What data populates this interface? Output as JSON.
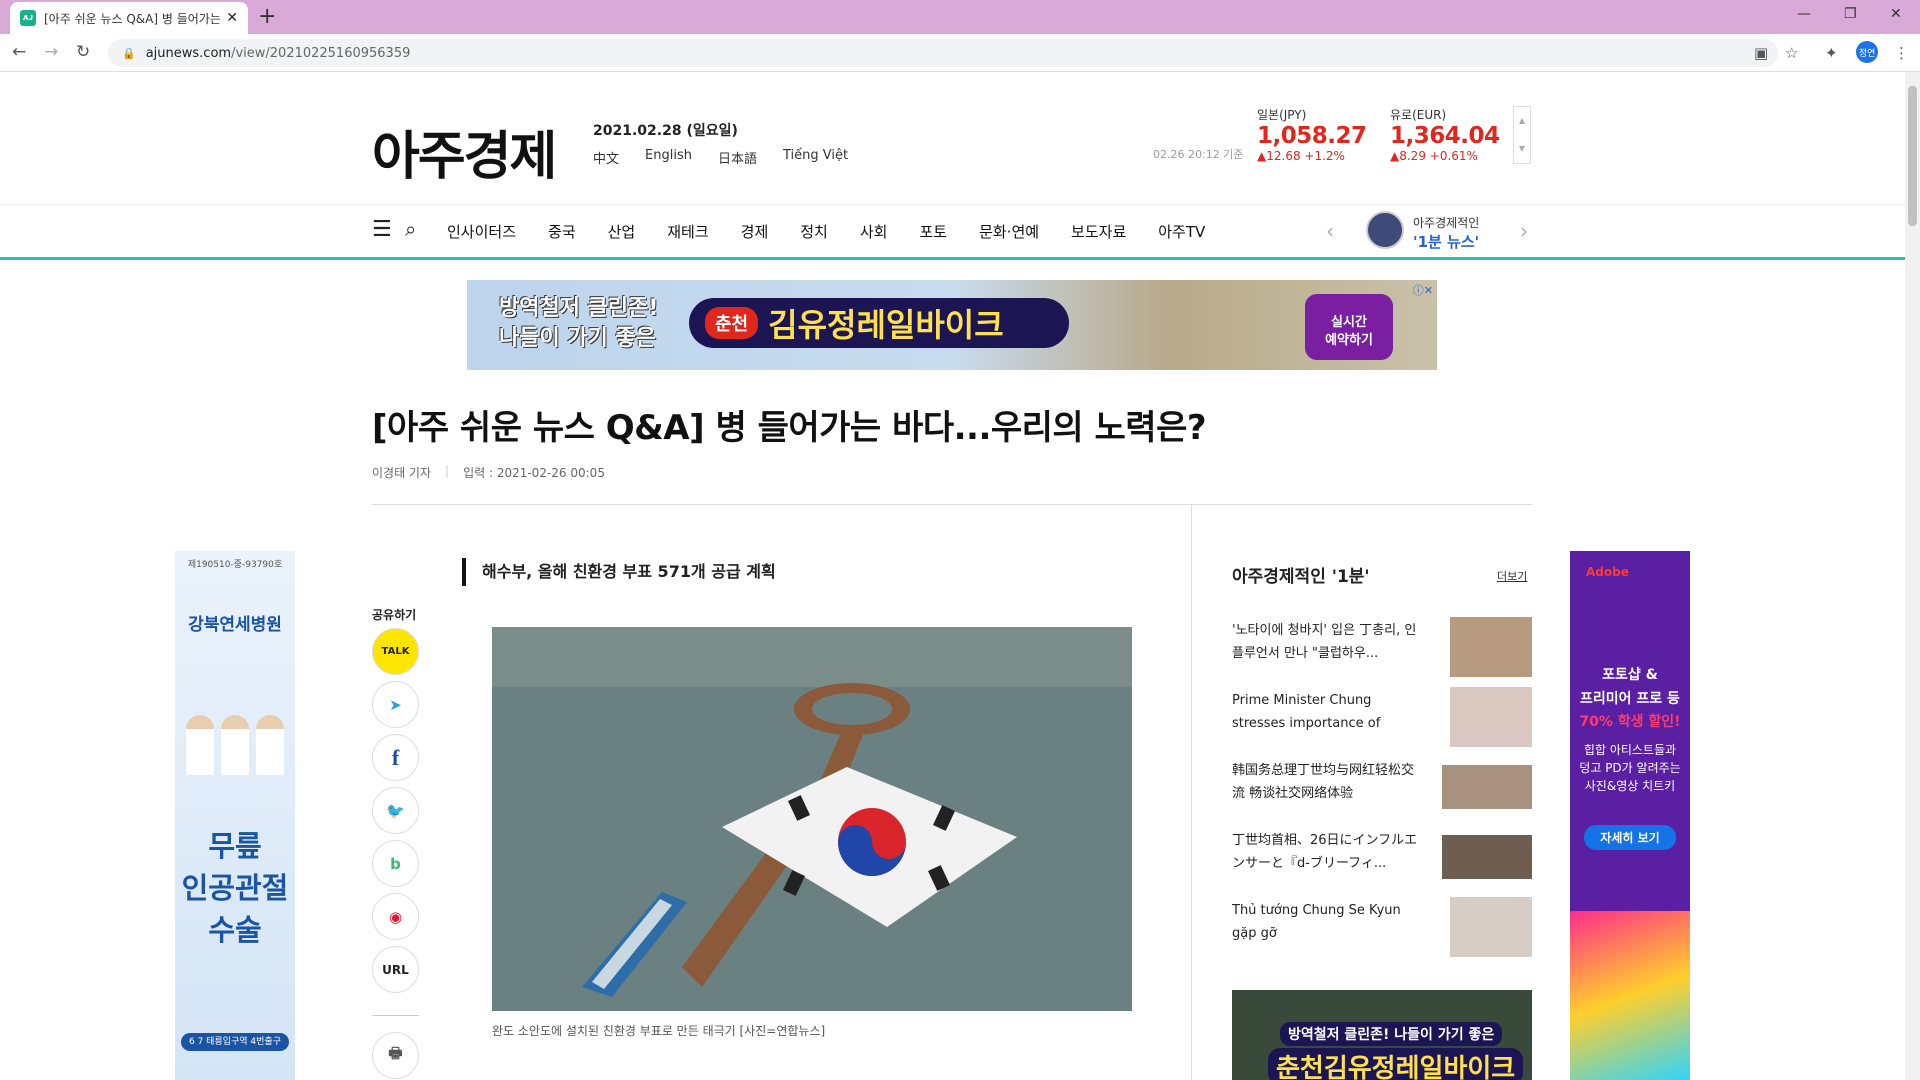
{
  "browser": {
    "tab_title": "[아주 쉬운 뉴스 Q&A] 병 들어가는",
    "tab_favicon": "ajunews",
    "url_host": "ajunews.com",
    "url_path": "/view/20210225160956359",
    "profile_label": "정연"
  },
  "header": {
    "logo": "아주경제",
    "date": "2021.02.28 (일요일)",
    "languages": [
      "中文",
      "English",
      "日本語",
      "Tiếng Việt"
    ],
    "rate_time": "02.26 20:12 기준",
    "rates": [
      {
        "name": "일본(JPY)",
        "value": "1,058.27",
        "change": "▲12.68  +1.2%"
      },
      {
        "name": "유로(EUR)",
        "value": "1,364.04",
        "change": "▲8.29  +0.61%"
      }
    ]
  },
  "nav": {
    "items": [
      "인사이터즈",
      "중국",
      "산업",
      "재테크",
      "경제",
      "정치",
      "사회",
      "포토",
      "문화·연예",
      "보도자료",
      "아주TV"
    ],
    "promo_line1": "아주경제적인",
    "promo_line2": "'1분 뉴스'"
  },
  "top_ad": {
    "line1": "방역철저 클린존!",
    "line2": "나들이 가기 좋은",
    "city": "춘천",
    "brand": "김유정레일바이크",
    "cta1": "실시간",
    "cta2": "예약하기"
  },
  "article": {
    "headline": "[아주 쉬운 뉴스 Q&A] 병 들어가는 바다...우리의 노력은?",
    "reporter": "이경태 기자",
    "published": "입력 : 2021-02-26 00:05",
    "subhead": "해수부, 올해 친환경 부표 571개 공급 계획",
    "caption": "완도 소안도에 설치된 친환경 부표로 만든 태극기 [사진=연합뉴스]"
  },
  "share": {
    "label": "공유하기",
    "buttons": [
      "TALK",
      "➤",
      "f",
      "🐦",
      "b",
      "◉",
      "URL",
      "🖶"
    ]
  },
  "left_ad": {
    "license": "제190510-중-93790호",
    "hospital": "강북연세병원",
    "big1": "무릎",
    "big2": "인공관절",
    "big3": "수술",
    "station": "6 7 태릉입구역 4번출구"
  },
  "sidebar": {
    "title": "아주경제적인 '1분'",
    "more": "더보기",
    "items": [
      "'노타이에 청바지' 입은 丁총리, 인플루언서 만나 \"클럽하우...",
      "Prime Minister Chung stresses importance of 'borderless...",
      "韩国务总理丁世均与网红轻松交流 畅谈社交网络体验",
      "丁世均首相、26日にインフルエンサーと『d-ブリーフィ...",
      "Thủ tướng Chung Se Kyun gặp gỡ influencer...\"Clubhouse là..."
    ]
  },
  "right_ad": {
    "brand": "Adobe",
    "p1a": "포토샵 &",
    "p1b": "프리미어 프로 등",
    "p2": "70% 학생 할인!",
    "p3a": "힙합 아티스트들과",
    "p3b": "덩고 PD가 알려주는",
    "p3c": "사진&영상 치트키",
    "button": "자세히 보기"
  },
  "colors": {
    "accent": "#27c3a8",
    "rate_red": "#e1261c",
    "tab_strip": "#d9a9d8"
  }
}
